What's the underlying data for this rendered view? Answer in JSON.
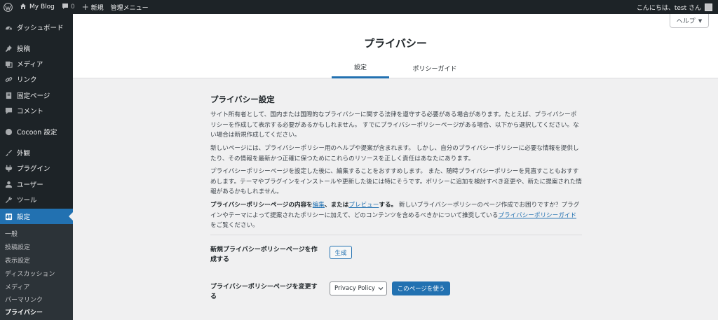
{
  "adminbar": {
    "site_name": "My Blog",
    "comments_count": "0",
    "new_label": "新規",
    "admin_menu_label": "管理メニュー",
    "greeting": "こんにちは、test さん"
  },
  "sidebar": {
    "items": [
      {
        "label": "ダッシュボード",
        "icon": "dashboard-icon"
      },
      {
        "label": "投稿",
        "icon": "pin-icon"
      },
      {
        "label": "メディア",
        "icon": "media-icon"
      },
      {
        "label": "リンク",
        "icon": "link-icon"
      },
      {
        "label": "固定ページ",
        "icon": "page-icon"
      },
      {
        "label": "コメント",
        "icon": "comment-icon"
      },
      {
        "label": "Cocoon 設定",
        "icon": "circle-icon"
      },
      {
        "label": "外観",
        "icon": "brush-icon"
      },
      {
        "label": "プラグイン",
        "icon": "plugin-icon"
      },
      {
        "label": "ユーザー",
        "icon": "user-icon"
      },
      {
        "label": "ツール",
        "icon": "wrench-icon"
      },
      {
        "label": "設定",
        "icon": "settings-icon"
      }
    ],
    "submenu": [
      "一般",
      "投稿設定",
      "表示設定",
      "ディスカッション",
      "メディア",
      "パーマリンク",
      "プライバシー"
    ]
  },
  "header": {
    "help_label": "ヘルプ",
    "title": "プライバシー",
    "tabs": [
      "設定",
      "ポリシーガイド"
    ]
  },
  "main": {
    "section_title": "プライバシー設定",
    "para1": "サイト所有者として、国内または国際的なプライバシーに関する法律を遵守する必要がある場合があります。たとえば、プライバシーポリシーを作成して表示する必要があるかもしれません。 すでにプライバシーポリシーページがある場合、以下から選択してください。ない場合は新規作成してください。",
    "para2": "新しいページには、プライバシーポリシー用のヘルプや提案が含まれます。 しかし、自分のプライバシーポリシーに必要な情報を提供したり、その情報を最新かつ正確に保つためにこれらのリソースを正しく責任はあなたにあります。",
    "para3": "プライバシーポリシーページを設定した後に、編集することをおすすめします。 また、随時プライバシーポリシーを見直すこともおすすめします。テーマやプラグインをインストールや更新した後には特にそうです。ポリシーに追加を検討すべき変更や、新たに提案された情報があるかもしれません。",
    "para4_bold1": "プライバシーポリシーページの内容を",
    "para4_link1": "編集",
    "para4_bold2": "、または",
    "para4_link2": "プレビュー",
    "para4_bold3": "する。",
    "para4_text": " 新しいプライバシーポリシーのページ作成でお困りですか？プラグインやテーマによって提案されたポリシーに加えて、どのコンテンツを含めるべきかについて推奨している",
    "para4_link3": "プライバシーポリシーガイド",
    "para4_end": "をご覧ください。",
    "create_label": "新規プライバシーポリシーページを作成する",
    "create_button": "生成",
    "change_label": "プライバシーポリシーページを変更する",
    "select_value": "Privacy Policy",
    "use_button": "このページを使う"
  },
  "colors": {
    "accent": "#2271b1",
    "adminbar_bg": "#1d2327",
    "submenu_bg": "#2c3338"
  }
}
